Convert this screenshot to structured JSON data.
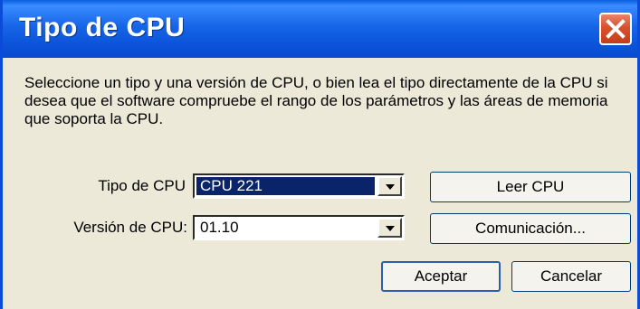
{
  "window": {
    "title": "Tipo de CPU",
    "close_icon": "close-icon"
  },
  "description": "Seleccione un tipo y una versión de CPU, o bien lea el tipo directamente de la CPU si desea que el software compruebe el rango de los parámetros y las áreas de memoria que soporta la CPU.",
  "cpu_type": {
    "label": "Tipo de CPU",
    "value": "CPU 221"
  },
  "cpu_version": {
    "label": "Versión de CPU:",
    "value": "01.10"
  },
  "buttons": {
    "read_cpu": "Leer CPU",
    "communication": "Comunicación...",
    "accept": "Aceptar",
    "cancel": "Cancelar"
  },
  "colors": {
    "titlebar": "#0a5fe0",
    "close_button": "#d9502c",
    "selection": "#0a246a",
    "dialog_bg": "#ece9d8"
  }
}
